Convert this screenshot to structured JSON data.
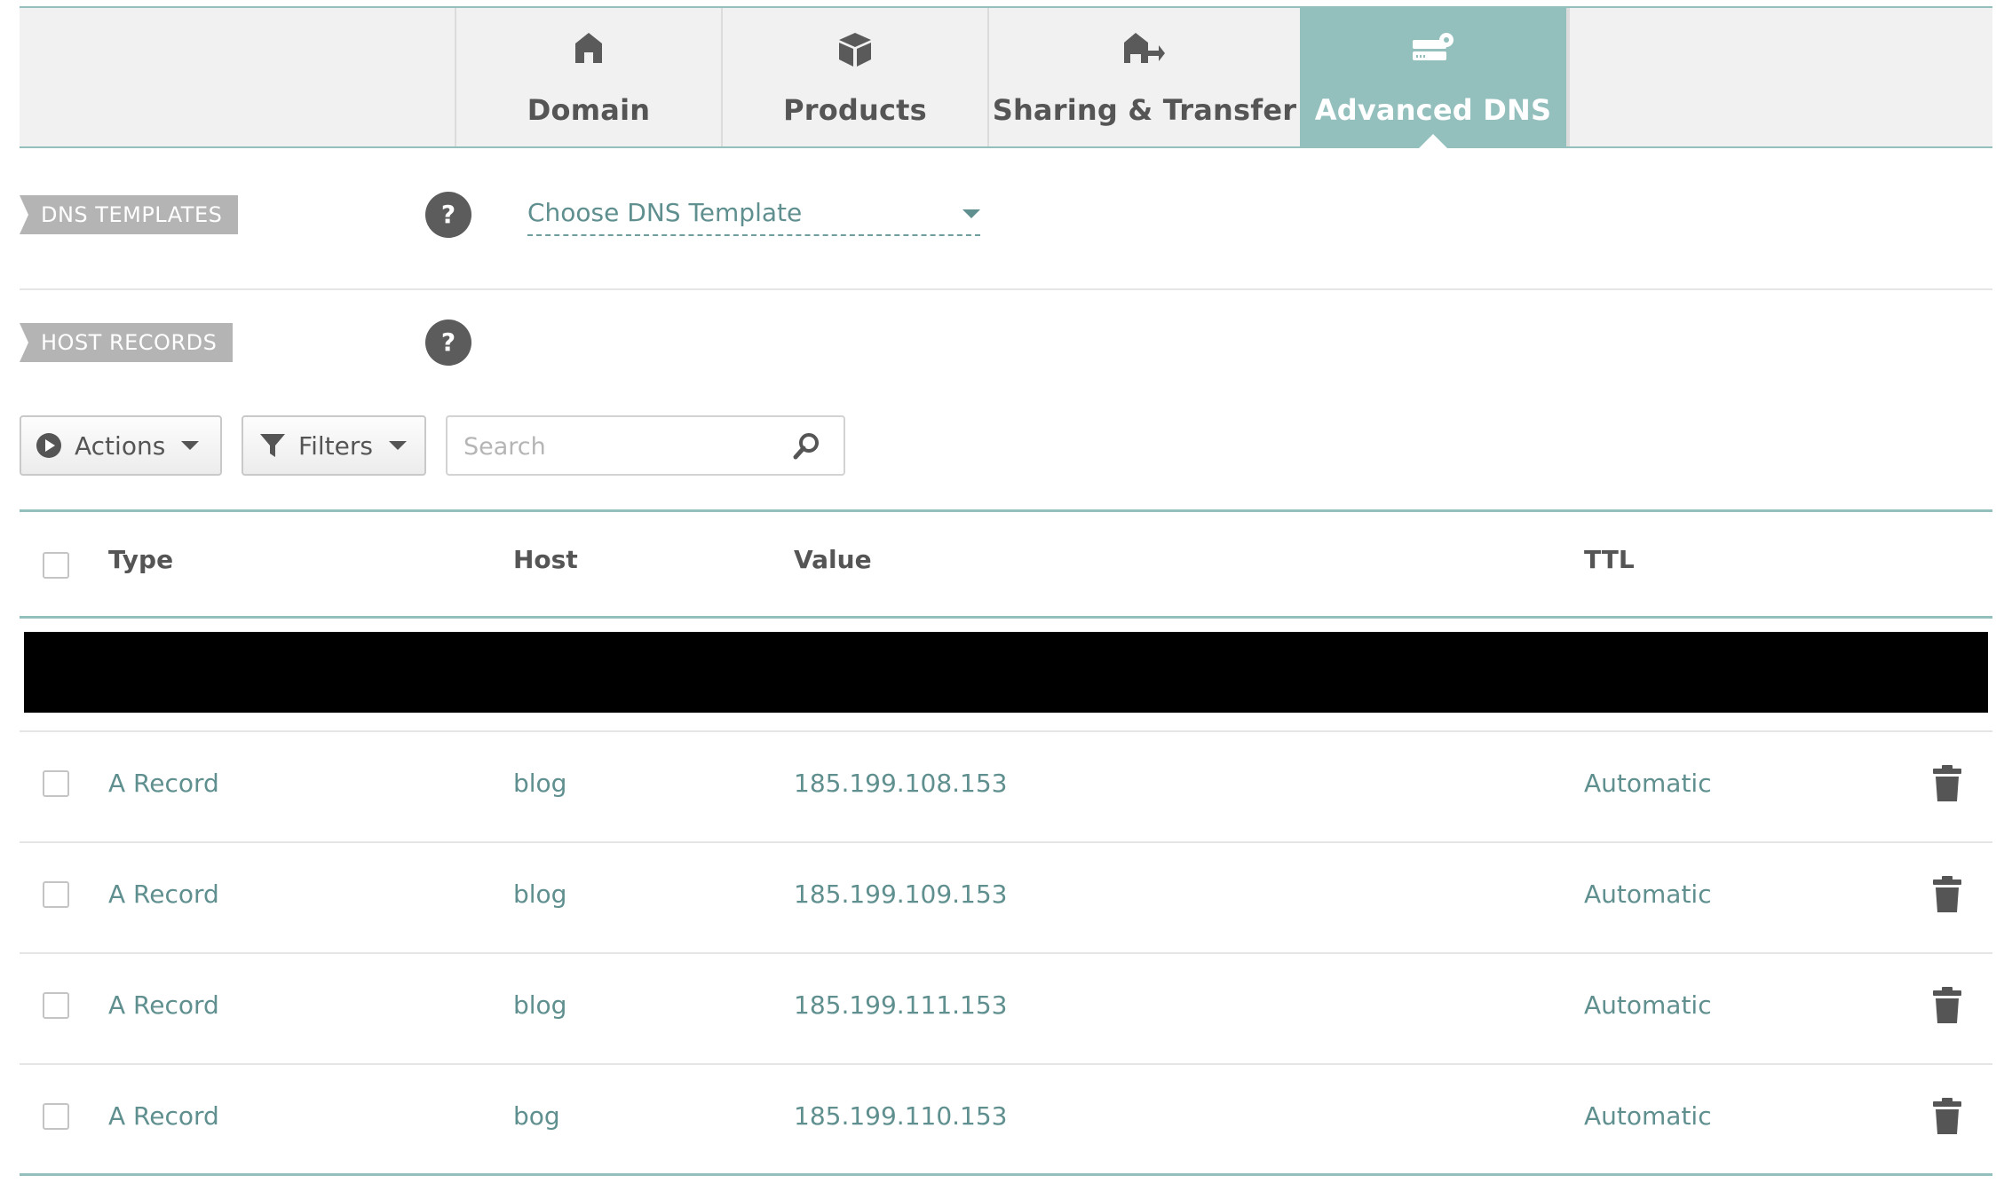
{
  "tabs": [
    {
      "label": "Domain",
      "icon": "home-icon",
      "active": false
    },
    {
      "label": "Products",
      "icon": "box-icon",
      "active": false
    },
    {
      "label": "Sharing & Transfer",
      "icon": "house-transfer-icon",
      "active": false
    },
    {
      "label": "Advanced DNS",
      "icon": "server-gear-icon",
      "active": true
    }
  ],
  "dns_templates": {
    "label": "DNS TEMPLATES",
    "help": "?",
    "select_value": "Choose DNS Template"
  },
  "host_records": {
    "label": "HOST RECORDS",
    "help": "?"
  },
  "toolbar": {
    "actions_label": "Actions",
    "filters_label": "Filters",
    "search_placeholder": "Search"
  },
  "table": {
    "columns": {
      "type": "Type",
      "host": "Host",
      "value": "Value",
      "ttl": "TTL"
    },
    "rows": [
      {
        "type": "A Record",
        "host": "blog",
        "value": "185.199.108.153",
        "ttl": "Automatic"
      },
      {
        "type": "A Record",
        "host": "blog",
        "value": "185.199.109.153",
        "ttl": "Automatic"
      },
      {
        "type": "A Record",
        "host": "blog",
        "value": "185.199.111.153",
        "ttl": "Automatic"
      },
      {
        "type": "A Record",
        "host": "bog",
        "value": "185.199.110.153",
        "ttl": "Automatic"
      }
    ]
  },
  "colors": {
    "accent": "#93bfbd",
    "link_text": "#5f8f8e",
    "tag_bg": "#b4b4b4",
    "redaction": "#000000"
  }
}
